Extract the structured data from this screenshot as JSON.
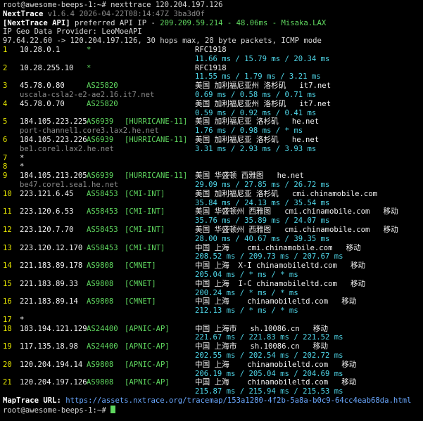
{
  "prompt": {
    "user_host": "root@awesome-beeps-1:~#",
    "command": "nexttrace 120.204.197.126"
  },
  "header": {
    "name": "NextTrace",
    "version": "v1.6.4 2026-04-22T08:14:47Z 3ba3d0f",
    "api_prefix": "[NextTrace API]",
    "api_text": " preferred API IP - ",
    "api_ip": "209.209.59.214",
    "api_sep": " - ",
    "api_latency": "48.06ms",
    "api_sep2": " - ",
    "api_node": "Misaka.LAX",
    "geo_provider": "IP Geo Data Provider: LeoMoeAPI",
    "trace_info": "97.64.22.60 -> 120.204.197.126, 30 hops max, 28 byte packets, ICMP mode"
  },
  "hops": [
    {
      "n": "1",
      "ip": "10.28.0.1",
      "asn": "*",
      "tag": "",
      "geo": "RFC1918",
      "latency": "11.66 ms / 15.79 ms / 20.34 ms"
    },
    {
      "n": "2",
      "ip": "10.28.255.10",
      "asn": "*",
      "tag": "",
      "geo": "RFC1918",
      "latency": "11.55 ms / 1.79 ms / 3.21 ms"
    },
    {
      "n": "3",
      "ip": "45.78.0.80",
      "asn": "AS25820",
      "tag": "",
      "geo": "美国 加利福尼亚州 洛杉矶   it7.net",
      "host": "uscala-csla2-e2-ae2.16.it7.net",
      "latency": "0.69 ms / 0.58 ms / 0.71 ms"
    },
    {
      "n": "4",
      "ip": "45.78.0.70",
      "asn": "AS25820",
      "tag": "",
      "geo": "美国 加利福尼亚州 洛杉矶   it7.net",
      "latency": "0.59 ms / 0.92 ms / 0.41 ms"
    },
    {
      "n": "5",
      "ip": "184.105.223.225",
      "asn": "AS6939",
      "tag": "[HURRICANE-11]",
      "geo": "美国 加利福尼亚 洛杉矶   he.net",
      "host": "port-channel1.core3.lax2.he.net",
      "latency": "1.76 ms / 0.98 ms / * ms"
    },
    {
      "n": "6",
      "ip": "184.105.223.226",
      "asn": "AS6939",
      "tag": "[HURRICANE-11]",
      "geo": "美国 加利福尼亚 洛杉矶   he.net",
      "host": "be1.core1.lax2.he.net",
      "latency": "3.31 ms / 2.93 ms / 3.93 ms"
    },
    {
      "n": "7",
      "star": true
    },
    {
      "n": "8",
      "star": true
    },
    {
      "n": "9",
      "ip": "184.105.213.205",
      "asn": "AS6939",
      "tag": "[HURRICANE-11]",
      "geo": "美国 华盛顿 西雅图   he.net",
      "host": "be47.core1.sea1.he.net",
      "latency": "29.09 ms / 27.85 ms / 26.72 ms"
    },
    {
      "n": "10",
      "ip": "223.121.6.45",
      "asn": "AS58453",
      "tag": "[CMI-INT]",
      "geo": "美国 加利福尼亚 洛杉矶   cmi.chinamobile.com",
      "latency": "35.84 ms / 24.13 ms / 35.54 ms"
    },
    {
      "n": "11",
      "ip": "223.120.6.53",
      "asn": "AS58453",
      "tag": "[CMI-INT]",
      "geo": "美国 华盛顿州 西雅图   cmi.chinamobile.com   移动",
      "latency": "35.76 ms / 35.89 ms / 24.07 ms"
    },
    {
      "n": "12",
      "ip": "223.120.7.70",
      "asn": "AS58453",
      "tag": "[CMI-INT]",
      "geo": "美国 华盛顿州 西雅图   cmi.chinamobile.com   移动",
      "latency": "28.00 ms / 40.67 ms / 39.35 ms"
    },
    {
      "n": "13",
      "ip": "223.120.12.170",
      "asn": "AS58453",
      "tag": "[CMI-INT]",
      "geo": "中国 上海    cmi.chinamobile.com   移动",
      "latency": "208.52 ms / 209.73 ms / 207.67 ms"
    },
    {
      "n": "14",
      "ip": "221.183.89.178",
      "asn": "AS9808",
      "tag": "[CMNET]",
      "geo": "中国 上海  X-I chinamobileltd.com   移动",
      "latency": "205.04 ms / * ms / * ms"
    },
    {
      "n": "15",
      "ip": "221.183.89.33",
      "asn": "AS9808",
      "tag": "[CMNET]",
      "geo": "中国 上海  I-C chinamobileltd.com   移动",
      "latency": "200.24 ms / * ms / * ms"
    },
    {
      "n": "16",
      "ip": "221.183.89.14",
      "asn": "AS9808",
      "tag": "[CMNET]",
      "geo": "中国 上海    chinamobileltd.com   移动",
      "latency": "212.13 ms / * ms / * ms"
    },
    {
      "n": "17",
      "star": true
    },
    {
      "n": "18",
      "ip": "183.194.121.129",
      "asn": "AS24400",
      "tag": "[APNIC-AP]",
      "geo": "中国 上海市   sh.10086.cn   移动",
      "latency": "221.67 ms / 221.83 ms / 221.52 ms"
    },
    {
      "n": "19",
      "ip": "117.135.18.98",
      "asn": "AS24400",
      "tag": "[APNIC-AP]",
      "geo": "中国 上海市   sh.10086.cn   移动",
      "latency": "202.55 ms / 202.54 ms / 202.72 ms"
    },
    {
      "n": "20",
      "ip": "120.204.194.14",
      "asn": "AS9808",
      "tag": "[APNIC-AP]",
      "geo": "中国 上海    chinamobileltd.com   移动",
      "latency": "206.19 ms / 205.04 ms / 204.69 ms"
    },
    {
      "n": "21",
      "ip": "120.204.197.126",
      "asn": "AS9808",
      "tag": "[APNIC-AP]",
      "geo": "中国 上海    chinamobileltd.com   移动",
      "latency": "215.87 ms / 215.94 ms / 215.53 ms"
    }
  ],
  "footer": {
    "maptrace_label": "MapTrace URL: ",
    "maptrace_url": "https://assets.nxtrace.org/tracemap/153a1280-4f2b-5a8a-b0c9-64cc4eab68da.html",
    "prompt": "root@awesome-beeps-1:~# "
  }
}
